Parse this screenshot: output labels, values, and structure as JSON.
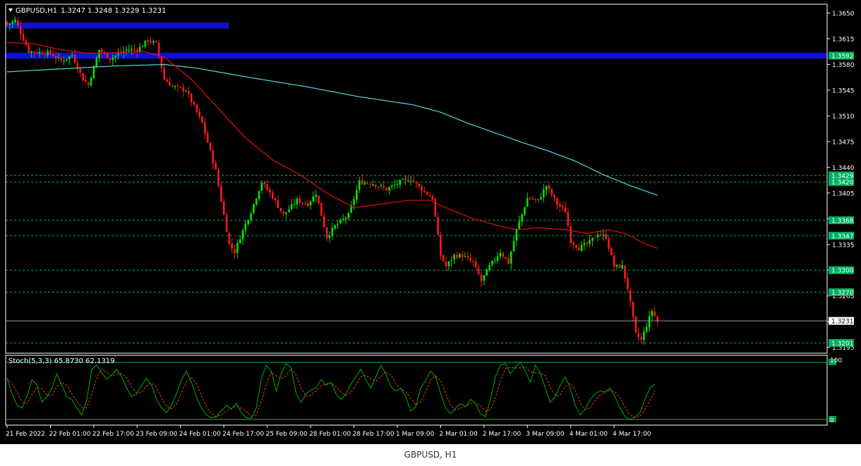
{
  "header": {
    "symbol": "GBPUSD,H1",
    "ohlc": "1.3247 1.3248 1.3229 1.3231",
    "caption": "GBPUSD, H1"
  },
  "stoch": {
    "label": "Stoch(5,3,3) 65.8730 62.1319",
    "level_high": "100",
    "level_low": "0"
  },
  "colors": {
    "background": "#000000",
    "bull": "#00e600",
    "bear": "#ff1a1a",
    "ma_fast": "#e01010",
    "ma_slow": "#4fd8d8",
    "zone": "#1010d0",
    "level": "#00b060",
    "axis": "#ffffff",
    "stoch_main": "#00b000",
    "stoch_signal": "#ff3030"
  },
  "chart_data": {
    "type": "candlestick",
    "symbol": "GBPUSD",
    "timeframe": "H1",
    "ylim": [
      1.3187,
      1.3662
    ],
    "price_ticks": [
      "1.3650",
      "1.3615",
      "1.3580",
      "1.3545",
      "1.3510",
      "1.3475",
      "1.3440",
      "1.3405",
      "1.3370",
      "1.3335",
      "1.3300",
      "1.3265",
      "1.3230",
      "1.3195"
    ],
    "time_labels": [
      "21 Feb 2022",
      "22 Feb 01:00",
      "22 Feb 17:00",
      "23 Feb 09:00",
      "24 Feb 01:00",
      "24 Feb 17:00",
      "25 Feb 09:00",
      "28 Feb 01:00",
      "28 Feb 17:00",
      "1 Mar 09:00",
      "2 Mar 01:00",
      "2 Mar 17:00",
      "3 Mar 09:00",
      "4 Mar 01:00",
      "4 Mar 17:00"
    ],
    "levels": [
      {
        "label": "1.3429",
        "value": 1.3429
      },
      {
        "label": "1.3420",
        "value": 1.342
      },
      {
        "label": "1.3368",
        "value": 1.3368
      },
      {
        "label": "1.3347",
        "value": 1.3347
      },
      {
        "label": "1.3300",
        "value": 1.33
      },
      {
        "label": "1.3270",
        "value": 1.327
      },
      {
        "label": "1.3201",
        "value": 1.3201
      }
    ],
    "zones": [
      {
        "label": "1.3592",
        "from": 1.3588,
        "to": 1.3596
      },
      {
        "label": "",
        "from": 1.3629,
        "to": 1.3637
      }
    ],
    "current_price": {
      "label": "1.3231",
      "value": 1.3231
    },
    "close_path": [
      [
        0,
        1.3634
      ],
      [
        3,
        1.364
      ],
      [
        8,
        1.3598
      ],
      [
        16,
        1.3595
      ],
      [
        20,
        1.3585
      ],
      [
        24,
        1.3593
      ],
      [
        28,
        1.356
      ],
      [
        30,
        1.3552
      ],
      [
        34,
        1.36
      ],
      [
        38,
        1.3588
      ],
      [
        44,
        1.36
      ],
      [
        48,
        1.36
      ],
      [
        52,
        1.3613
      ],
      [
        55,
        1.3608
      ],
      [
        58,
        1.356
      ],
      [
        61,
        1.355
      ],
      [
        66,
        1.3545
      ],
      [
        72,
        1.35
      ],
      [
        77,
        1.3435
      ],
      [
        80,
        1.3375
      ],
      [
        82,
        1.3335
      ],
      [
        84,
        1.3325
      ],
      [
        86,
        1.3345
      ],
      [
        90,
        1.338
      ],
      [
        94,
        1.342
      ],
      [
        98,
        1.34
      ],
      [
        102,
        1.3375
      ],
      [
        107,
        1.3395
      ],
      [
        111,
        1.339
      ],
      [
        114,
        1.3405
      ],
      [
        118,
        1.3345
      ],
      [
        121,
        1.336
      ],
      [
        126,
        1.3375
      ],
      [
        130,
        1.342
      ],
      [
        135,
        1.3418
      ],
      [
        140,
        1.341
      ],
      [
        145,
        1.342
      ],
      [
        149,
        1.3424
      ],
      [
        153,
        1.341
      ],
      [
        157,
        1.3398
      ],
      [
        160,
        1.332
      ],
      [
        162,
        1.3305
      ],
      [
        165,
        1.332
      ],
      [
        168,
        1.332
      ],
      [
        172,
        1.331
      ],
      [
        175,
        1.3285
      ],
      [
        178,
        1.3305
      ],
      [
        182,
        1.3325
      ],
      [
        185,
        1.331
      ],
      [
        188,
        1.3355
      ],
      [
        192,
        1.3398
      ],
      [
        196,
        1.3395
      ],
      [
        199,
        1.3415
      ],
      [
        203,
        1.339
      ],
      [
        206,
        1.338
      ],
      [
        208,
        1.334
      ],
      [
        211,
        1.333
      ],
      [
        215,
        1.3338
      ],
      [
        218,
        1.335
      ],
      [
        221,
        1.3345
      ],
      [
        224,
        1.3305
      ],
      [
        227,
        1.3305
      ],
      [
        229,
        1.3275
      ],
      [
        232,
        1.3213
      ],
      [
        234,
        1.3205
      ],
      [
        236,
        1.3225
      ],
      [
        238,
        1.3245
      ],
      [
        240,
        1.3231
      ]
    ],
    "ma_fast_path": [
      [
        0,
        1.361
      ],
      [
        10,
        1.3608
      ],
      [
        20,
        1.36
      ],
      [
        30,
        1.3595
      ],
      [
        40,
        1.3596
      ],
      [
        50,
        1.3598
      ],
      [
        58,
        1.359
      ],
      [
        68,
        1.356
      ],
      [
        78,
        1.352
      ],
      [
        88,
        1.348
      ],
      [
        98,
        1.345
      ],
      [
        108,
        1.343
      ],
      [
        118,
        1.3405
      ],
      [
        128,
        1.3385
      ],
      [
        138,
        1.339
      ],
      [
        148,
        1.3395
      ],
      [
        156,
        1.3395
      ],
      [
        162,
        1.3385
      ],
      [
        172,
        1.337
      ],
      [
        182,
        1.336
      ],
      [
        188,
        1.3355
      ],
      [
        196,
        1.3358
      ],
      [
        206,
        1.3355
      ],
      [
        214,
        1.335
      ],
      [
        222,
        1.3355
      ],
      [
        228,
        1.335
      ],
      [
        236,
        1.3335
      ],
      [
        240,
        1.333
      ]
    ],
    "ma_slow_path": [
      [
        0,
        1.357
      ],
      [
        20,
        1.3574
      ],
      [
        40,
        1.3578
      ],
      [
        58,
        1.358
      ],
      [
        70,
        1.3575
      ],
      [
        90,
        1.3562
      ],
      [
        110,
        1.355
      ],
      [
        130,
        1.3536
      ],
      [
        150,
        1.3525
      ],
      [
        160,
        1.3515
      ],
      [
        170,
        1.35
      ],
      [
        180,
        1.3487
      ],
      [
        190,
        1.3474
      ],
      [
        200,
        1.3462
      ],
      [
        210,
        1.3448
      ],
      [
        220,
        1.343
      ],
      [
        230,
        1.3415
      ],
      [
        240,
        1.3402
      ]
    ],
    "stoch_main": [
      72,
      45,
      25,
      20,
      40,
      70,
      60,
      30,
      40,
      55,
      80,
      60,
      40,
      35,
      20,
      8,
      35,
      88,
      95,
      82,
      70,
      78,
      88,
      75,
      55,
      40,
      45,
      60,
      72,
      60,
      35,
      20,
      12,
      25,
      45,
      70,
      85,
      65,
      40,
      20,
      8,
      3,
      5,
      15,
      25,
      18,
      28,
      12,
      3,
      2,
      20,
      70,
      95,
      85,
      50,
      80,
      98,
      90,
      45,
      30,
      45,
      52,
      55,
      70,
      60,
      65,
      45,
      35,
      45,
      62,
      75,
      88,
      70,
      55,
      75,
      95,
      80,
      58,
      50,
      55,
      40,
      15,
      22,
      55,
      68,
      85,
      75,
      45,
      20,
      10,
      20,
      28,
      22,
      35,
      28,
      10,
      5,
      35,
      75,
      95,
      98,
      80,
      92,
      100,
      85,
      65,
      95,
      82,
      55,
      30,
      40,
      60,
      75,
      55,
      25,
      8,
      18,
      35,
      45,
      50,
      48,
      55,
      40,
      20,
      5,
      0,
      5,
      12,
      35,
      55,
      62
    ]
  }
}
